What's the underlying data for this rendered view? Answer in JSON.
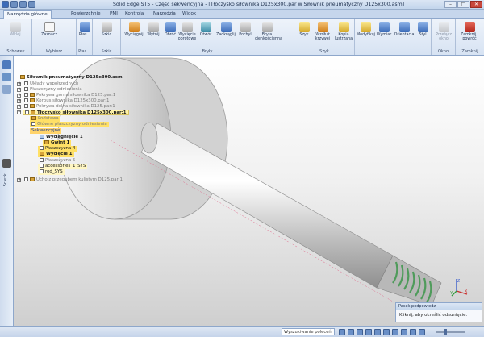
{
  "window": {
    "title": "Solid Edge ST5 - Część sekwencyjna - [Tłoczysko siłownika D125x300.par w Siłownik pneumatyczny D125x300.asm]"
  },
  "tabs": [
    {
      "label": "Narzędzia główne"
    },
    {
      "label": "Powierzchnie"
    },
    {
      "label": "PMI"
    },
    {
      "label": "Kontrola"
    },
    {
      "label": "Narzędzia"
    },
    {
      "label": "Widok"
    }
  ],
  "ribbon": {
    "groups": [
      {
        "label": "Schowek"
      },
      {
        "label": "Wybierz"
      },
      {
        "label": "Płas..."
      },
      {
        "label": "Szkic"
      },
      {
        "label": "Bryły"
      },
      {
        "label": "Szyk"
      },
      {
        "label": "Okno"
      },
      {
        "label": "Zamknij"
      }
    ],
    "buttons": {
      "paste": "Wklej",
      "select": "Zaznacz",
      "plane": "Płas...",
      "sketch": "Szkic",
      "extrude": "Wyciągnij",
      "cut": "Wytnij",
      "revolve": "Obróć",
      "revcut": "Wycięcie obrotowe",
      "hole": "Otwór",
      "round": "Zaokrąglij",
      "draft": "Pochyl",
      "thin": "Bryła cienkościenna",
      "pattern": "Szyk",
      "curve_pattern": "Wzdłuż krzywej",
      "sheet": "Kopia lustrzana",
      "modify": "Modyfikuj",
      "dimension": "Wymiar",
      "orient": "Orientacja",
      "style": "Styl",
      "switch_window": "Przełącz okno",
      "close_return": "Zamknij i powróć"
    }
  },
  "sidebar": {
    "label": "Ścieżki"
  },
  "tree": {
    "root": "Siłownik pneumatyczny D125x300.asm",
    "items": [
      {
        "label": "Układy współrzędnych"
      },
      {
        "label": "Płaszczyzny odniesienia"
      },
      {
        "label": "Pokrywa górna siłownika D125.par:1"
      },
      {
        "label": "Korpus siłownika D125x300.par:1"
      },
      {
        "label": "Pokrywa dolna siłownika D125.par:1"
      },
      {
        "label": "Tłoczysko siłownika D125x300.par:1"
      },
      {
        "label": "Podstawa"
      },
      {
        "label": "Główne płaszczyzny odniesienia"
      },
      {
        "label": "Sekwencyjne"
      },
      {
        "label": "Wyciągnięcie 1"
      },
      {
        "label": "Gwint 1"
      },
      {
        "label": "Płaszczyzna 4"
      },
      {
        "label": "Wycięcie 1"
      },
      {
        "label": "Płaszczyzna 5"
      },
      {
        "label": "accessories_1_SYS"
      },
      {
        "label": "rod_SYS"
      },
      {
        "label": "Ucho z przegubem kulistym D125.par:1"
      }
    ]
  },
  "prompt": {
    "header": "Pasek podpowiedzi",
    "text": "Kliknij, aby określić odsunięcie."
  },
  "triad": {
    "x": "X",
    "y": "Y",
    "z": "Z"
  },
  "status": {
    "command_search": "Wyszukiwanie poleceń"
  },
  "colors": {
    "ribbon_bg": "#dfe8f4",
    "viewport_top": "#ffffff",
    "viewport_bottom": "#cfcfcf",
    "tree_highlight": "#ffe066",
    "thread_green": "#4f9b5b"
  }
}
